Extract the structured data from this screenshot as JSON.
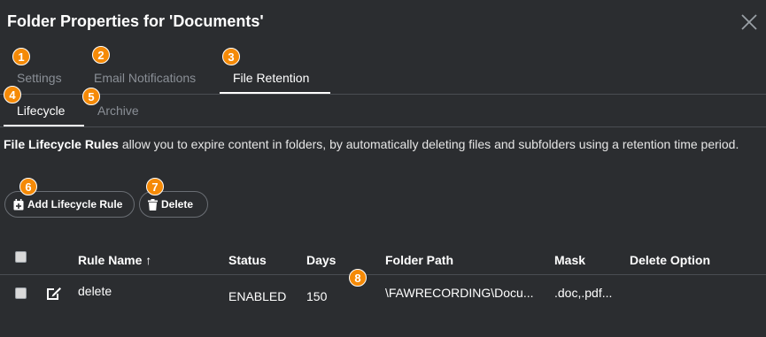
{
  "dialog": {
    "title": "Folder Properties for 'Documents'",
    "close_icon": "close-icon"
  },
  "tabs": [
    {
      "label": "Settings",
      "active": false
    },
    {
      "label": "Email Notifications",
      "active": false
    },
    {
      "label": "File Retention",
      "active": true
    }
  ],
  "subtabs": [
    {
      "label": "Lifecycle",
      "active": true
    },
    {
      "label": "Archive",
      "active": false
    }
  ],
  "description": {
    "bold": "File Lifecycle Rules",
    "text": " allow you to expire content in folders, by automatically deleting files and subfolders using a retention time period."
  },
  "toolbar": {
    "add_label": "Add Lifecycle Rule",
    "add_icon": "calendar-plus-icon",
    "delete_label": "Delete",
    "delete_icon": "trash-icon"
  },
  "table": {
    "columns": [
      "Rule Name",
      "Status",
      "Days",
      "Folder Path",
      "Mask",
      "Delete Option"
    ],
    "sort_indicator": "↑",
    "rows": [
      {
        "rule_name": "delete",
        "status": "ENABLED",
        "days": "150",
        "folder_path": "\\FAWRECORDING\\Docu...",
        "mask": ".doc,.pdf...",
        "delete_option": ""
      }
    ]
  },
  "badges": [
    "1",
    "2",
    "3",
    "4",
    "5",
    "6",
    "7",
    "8"
  ],
  "colors": {
    "background": "#2b2d30",
    "badge": "#f58a07",
    "muted_text": "#8a8f96",
    "divider": "#4a4d52"
  }
}
